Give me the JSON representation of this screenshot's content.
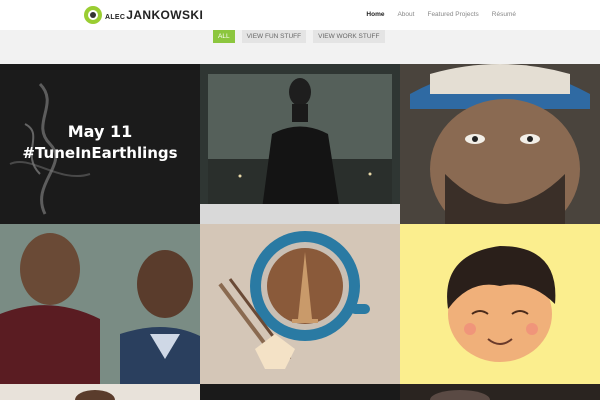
{
  "header": {
    "logo": {
      "small": "ALEC",
      "big": "JANKOWSKI"
    },
    "nav": [
      {
        "label": "Home",
        "active": true
      },
      {
        "label": "About",
        "active": false
      },
      {
        "label": "Featured Projects",
        "active": false
      },
      {
        "label": "Résumé",
        "active": false
      }
    ]
  },
  "filters": [
    {
      "label": "ALL",
      "active": true
    },
    {
      "label": "VIEW FUN STUFF",
      "active": false
    },
    {
      "label": "VIEW WORK STUFF",
      "active": false
    }
  ],
  "tiles": [
    {
      "name": "earthlings-promo",
      "lines": [
        "May 11",
        "#TuneInEarthlings"
      ]
    },
    {
      "name": "man-window-photo"
    },
    {
      "name": "man-cap-portrait"
    },
    {
      "name": "two-men-photo"
    },
    {
      "name": "coffee-paris-illustration"
    },
    {
      "name": "cartoon-face-illustration"
    },
    {
      "name": "tile-row3-left"
    },
    {
      "name": "tile-row3-mid"
    },
    {
      "name": "tile-row3-right"
    }
  ],
  "colors": {
    "accent": "#8cc63e",
    "filterbar": "#f2f2f2"
  }
}
